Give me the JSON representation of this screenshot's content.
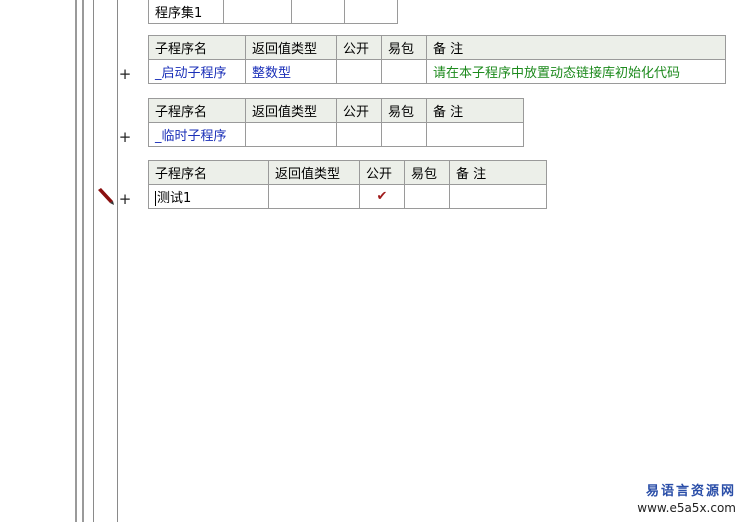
{
  "program_set": {
    "label": "程序集1"
  },
  "columns": {
    "name": "子程序名",
    "return_type": "返回值类型",
    "public": "公开",
    "easy_pack": "易包",
    "note": "备 注"
  },
  "subroutines": [
    {
      "name": "_启动子程序",
      "return_type": "整数型",
      "public": false,
      "note": "请在本子程序中放置动态链接库初始化代码"
    },
    {
      "name": "_临时子程序",
      "return_type": "",
      "public": false,
      "note": ""
    },
    {
      "name": "测试1",
      "return_type": "",
      "public": true,
      "note": "",
      "editing": true
    }
  ],
  "expand_symbol": "+",
  "check_symbol": "✔",
  "icons": {
    "expand": "plus-icon",
    "edit": "pencil-icon",
    "public": "checkmark-icon"
  },
  "colors": {
    "header_bg": "#ecefe9",
    "type_text": "#1a2fb8",
    "note_text": "#1d8a1d",
    "check": "#a01b1b"
  },
  "watermark": {
    "title": "易语言资源网",
    "url": "www.e5a5x.com"
  }
}
